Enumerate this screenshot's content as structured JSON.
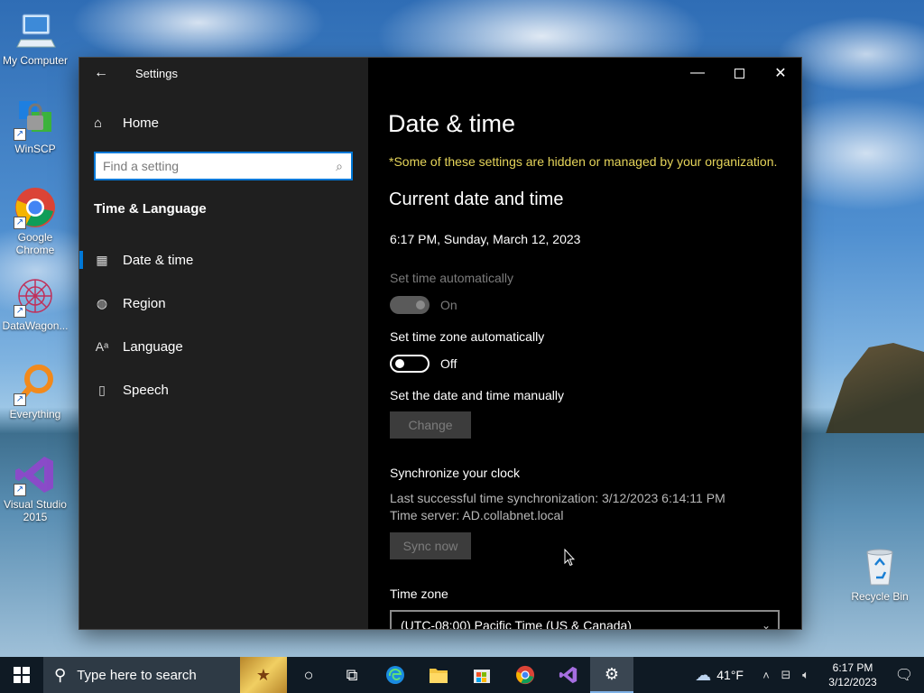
{
  "desktop": {
    "icons": [
      {
        "label": "My Computer"
      },
      {
        "label": "WinSCP"
      },
      {
        "label": "Google Chrome"
      },
      {
        "label": "DataWagon..."
      },
      {
        "label": "Everything"
      },
      {
        "label": "Visual Studio 2015"
      },
      {
        "label": "Recycle Bin"
      }
    ]
  },
  "window": {
    "title": "Settings",
    "sidebar": {
      "home_label": "Home",
      "search_placeholder": "Find a setting",
      "section_title": "Time & Language",
      "items": [
        {
          "label": "Date & time",
          "icon": "date-time-icon",
          "active": true
        },
        {
          "label": "Region",
          "icon": "globe-icon",
          "active": false
        },
        {
          "label": "Language",
          "icon": "language-icon",
          "active": false
        },
        {
          "label": "Speech",
          "icon": "microphone-icon",
          "active": false
        }
      ]
    },
    "content": {
      "page_title": "Date & time",
      "managed_note": "*Some of these settings are hidden or managed by your organization.",
      "current_heading": "Current date and time",
      "current_datetime": "6:17 PM, Sunday, March 12, 2023",
      "set_time_auto": {
        "label": "Set time automatically",
        "state": "On"
      },
      "set_tz_auto": {
        "label": "Set time zone automatically",
        "state": "Off"
      },
      "manual": {
        "label": "Set the date and time manually",
        "button": "Change"
      },
      "sync": {
        "heading": "Synchronize your clock",
        "last_sync": "Last successful time synchronization: 3/12/2023 6:14:11 PM",
        "server": "Time server: AD.collabnet.local",
        "button": "Sync now"
      },
      "timezone": {
        "label": "Time zone",
        "value": "(UTC-08:00) Pacific Time (US & Canada)"
      }
    }
  },
  "taskbar": {
    "search_placeholder": "Type here to search",
    "weather": "41°F",
    "time": "6:17 PM",
    "date": "3/12/2023"
  },
  "colors": {
    "accent": "#0078d7",
    "managed_note": "#e5d45a",
    "window_bg": "#000000",
    "sidebar_bg": "#1f1f1f"
  }
}
